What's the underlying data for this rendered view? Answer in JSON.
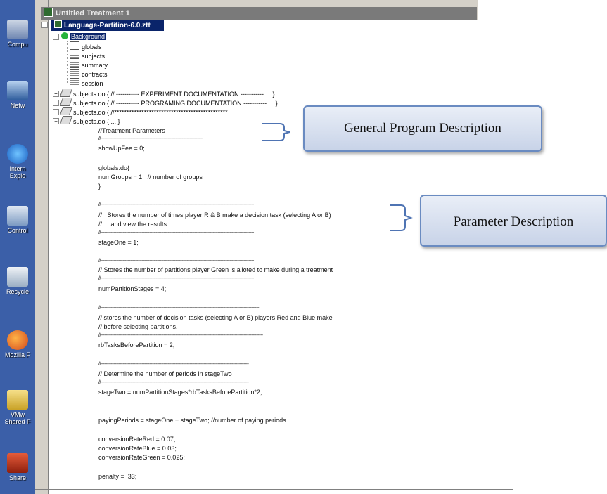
{
  "desktop": {
    "icons": [
      {
        "label": "Compu",
        "icon": "computer-icon"
      },
      {
        "label": "Netw",
        "icon": "network-icon"
      },
      {
        "label": "Intern\nExplo",
        "icon": "internet-explorer-icon"
      },
      {
        "label": "Control",
        "icon": "control-panel-icon"
      },
      {
        "label": "Recycle",
        "icon": "recycle-bin-icon"
      },
      {
        "label": "Mozilla F",
        "icon": "firefox-icon"
      },
      {
        "label": "VMw\nShared F",
        "icon": "vmware-folder-icon"
      },
      {
        "label": "Share",
        "icon": "share-icon"
      }
    ]
  },
  "window": {
    "title": "Untitled Treatment 1"
  },
  "tree": {
    "root": "Language-Partition-6.0.ztt",
    "background": "Background",
    "tables": [
      "globals",
      "subjects",
      "summary",
      "contracts",
      "session"
    ],
    "programs": [
      "subjects.do { // ----------- EXPERIMENT DOCUMENTATION ----------- ... }",
      "subjects.do { // ----------- PROGRAMING DOCUMENTATION ----------- ... }",
      "subjects.do { //**********************************************",
      "subjects.do { ... }"
    ]
  },
  "code": {
    "l1": "//Treatment Parameters",
    "l2": "//-------------------------------------------------------------------------------",
    "l3": "showUpFee = 0;",
    "l4": "globals.do{",
    "l5": "numGroups = 1;  // number of groups",
    "l6": "}",
    "l7": "//-----------------------------------------------------------------------------------------------------------------------",
    "l8": "//   Stores the number of times player R & B make a decision task (selecting A or B)",
    "l9": "//     and view the results",
    "l10": "//-----------------------------------------------------------------------------------------------------------------------",
    "l11": "stageOne = 1;",
    "l12": "//-----------------------------------------------------------------------------------------------------------------------",
    "l13": "// Stores the number of partitions player Green is alloted to make during a treatment",
    "l14": "//-----------------------------------------------------------------------------------------------------------------------",
    "l15": "numPartitionStages = 4;",
    "l16": "//---------------------------------------------------------------------------------------------------------------------------",
    "l17": "// stores the number of decision tasks (selecting A or B) players Red and Blue make",
    "l18": "// before selecting partitions.",
    "l19": "//------------------------------------------------------------------------------------------------------------------------------",
    "l20": "rbTasksBeforePartition = 2;",
    "l21": "//-------------------------------------------------------------------------------------------------------------------",
    "l22": "// Determine the number of periods in stageTwo",
    "l23": "//-------------------------------------------------------------------------------------------------------------------",
    "l24": "stageTwo = numPartitionStages*rbTasksBeforePartition*2;",
    "l25": "payingPeriods = stageOne + stageTwo; //number of paying periods",
    "l26": "conversionRateRed = 0.07;",
    "l27": "conversionRateBlue = 0.03;",
    "l28": "conversionRateGreen = 0.025;",
    "l29": "penalty = .33;"
  },
  "callouts": {
    "general": "General Program Description",
    "parameter": "Parameter Description"
  }
}
